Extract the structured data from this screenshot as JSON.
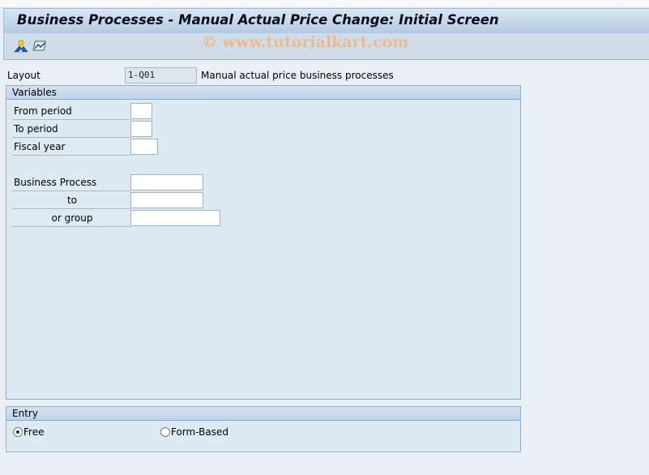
{
  "window": {
    "title": "Business Processes - Manual Actual Price Change: Initial Screen"
  },
  "toolbar": {
    "watermark": "© www.tutorialkart.com",
    "icons": [
      {
        "name": "person-mountain-icon"
      },
      {
        "name": "chart-line-icon"
      }
    ]
  },
  "layout": {
    "label": "Layout",
    "value": "1-Q01",
    "description": "Manual actual price business processes"
  },
  "variables": {
    "title": "Variables",
    "fields": {
      "from_period": {
        "label": "From period",
        "value": ""
      },
      "to_period": {
        "label": "To period",
        "value": ""
      },
      "fiscal_year": {
        "label": "Fiscal year",
        "value": ""
      },
      "business_process": {
        "label": "Business Process",
        "value": ""
      },
      "business_process_to": {
        "label": "to",
        "value": ""
      },
      "or_group": {
        "label": "or group",
        "value": ""
      }
    }
  },
  "entry": {
    "title": "Entry",
    "options": [
      {
        "label": "Free",
        "selected": true
      },
      {
        "label": "Form-Based",
        "selected": false
      }
    ]
  },
  "colors": {
    "background": "#e8eff7",
    "group_background": "#dde9f3",
    "watermark": "#efb98b"
  }
}
